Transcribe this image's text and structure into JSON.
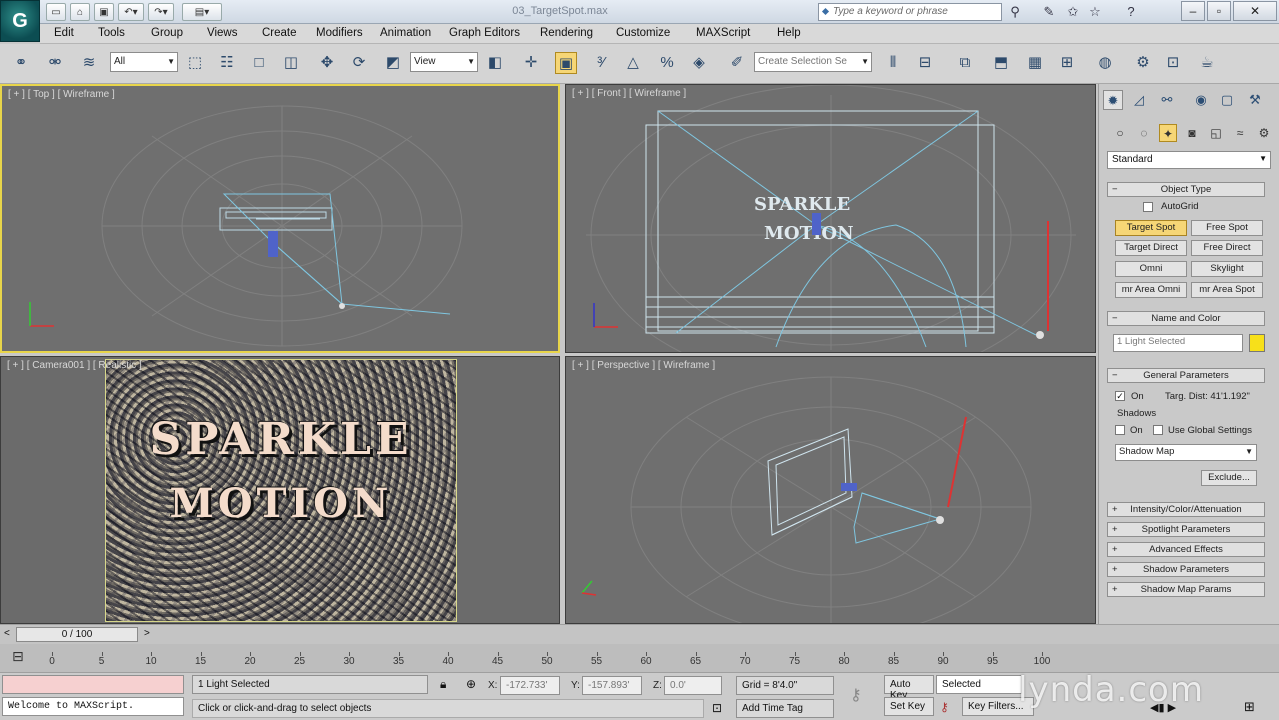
{
  "window": {
    "title": "03_TargetSpot.max",
    "search_placeholder": "Type a keyword or phrase",
    "logo": "G"
  },
  "menu": [
    "Edit",
    "Tools",
    "Group",
    "Views",
    "Create",
    "Modifiers",
    "Animation",
    "Graph Editors",
    "Rendering",
    "Customize",
    "MAXScript",
    "Help"
  ],
  "toolbar": {
    "selection_filter": "All",
    "reference_coord": "View",
    "named_selection_placeholder": "Create Selection Se"
  },
  "viewports": {
    "top": "[ + ] [ Top ] [ Wireframe ]",
    "front": "[ + ] [ Front ] [ Wireframe ]",
    "camera": "[ + ] [ Camera001 ] [ Realistic ]",
    "perspective": "[ + ] [ Perspective ] [ Wireframe ]",
    "scene_title_line1": "SPARKLE",
    "scene_title_line2": "MOTION"
  },
  "command_panel": {
    "category": "Standard",
    "object_type": {
      "header": "Object Type",
      "autogrid": "AutoGrid",
      "buttons": [
        "Target Spot",
        "Free Spot",
        "Target Direct",
        "Free Direct",
        "Omni",
        "Skylight",
        "mr Area Omni",
        "mr Area Spot"
      ]
    },
    "name_and_color": {
      "header": "Name and Color",
      "name_value": "1 Light Selected",
      "color": "#f7e01a"
    },
    "general_parameters": {
      "header": "General Parameters",
      "on_label": "On",
      "targ_dist": "Targ. Dist: 41'1.192\"",
      "shadows_label": "Shadows",
      "shadow_on": "On",
      "use_global": "Use Global Settings",
      "shadow_type": "Shadow Map",
      "exclude": "Exclude..."
    },
    "collapsed_rollouts": [
      "Intensity/Color/Attenuation",
      "Spotlight Parameters",
      "Advanced Effects",
      "Shadow Parameters",
      "Shadow Map Params"
    ]
  },
  "timeline": {
    "frame_display": "0 / 100",
    "ticks": [
      "0",
      "5",
      "10",
      "15",
      "20",
      "25",
      "30",
      "35",
      "40",
      "45",
      "50",
      "55",
      "60",
      "65",
      "70",
      "75",
      "80",
      "85",
      "90",
      "95",
      "100"
    ]
  },
  "status": {
    "maxscript_listener": "Welcome to MAXScript.",
    "selection_info": "1 Light Selected",
    "prompt": "Click or click-and-drag to select objects",
    "x_label": "X:",
    "x_value": "-172.733'",
    "y_label": "Y:",
    "y_value": "-157.893'",
    "z_label": "Z:",
    "z_value": "0.0'",
    "grid": "Grid = 8'4.0\"",
    "add_time_tag": "Add Time Tag",
    "auto_key": "Auto Key",
    "set_key": "Set Key",
    "key_mode": "Selected",
    "key_filters": "Key Filters..."
  },
  "watermark": "lynda.com",
  "colors": {
    "viewport_bg": "#6f6f6f",
    "active_border": "#e8d54a",
    "wire": "#8fd0e6",
    "active_tool": "#f6d676"
  }
}
